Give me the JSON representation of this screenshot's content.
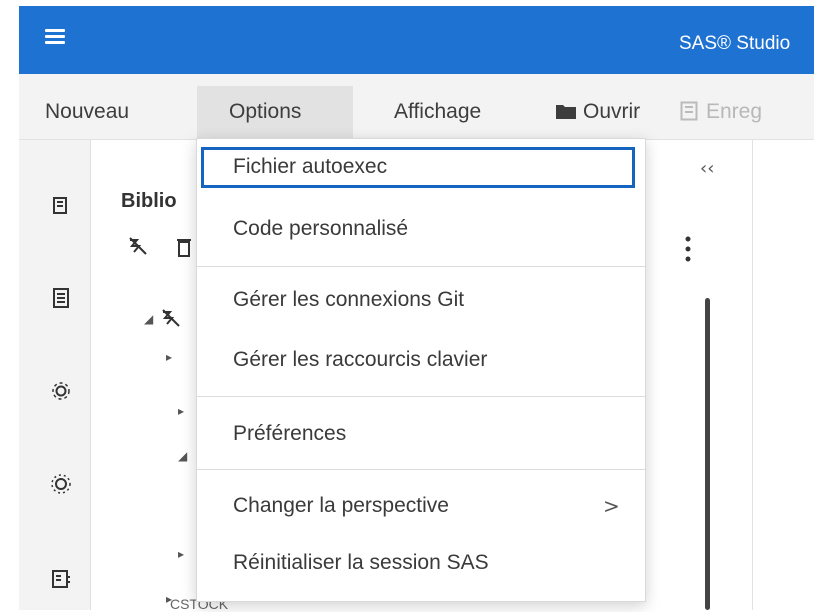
{
  "app": {
    "title": "SAS® Studio"
  },
  "menubar": {
    "new_label": "Nouveau",
    "options_label": "Options",
    "view_label": "Affichage",
    "open_label": "Ouvrir",
    "save_label": "Enreg"
  },
  "panel": {
    "title": "Biblio",
    "collapse_glyph": "‹‹"
  },
  "dropdown": {
    "items": [
      {
        "label": "Fichier autoexec",
        "focused": true
      },
      {
        "label": "Code personnalisé"
      },
      {
        "label": "Gérer les connexions Git"
      },
      {
        "label": "Gérer les raccourcis clavier"
      },
      {
        "label": "Préférences"
      },
      {
        "label": "Changer la perspective",
        "submenu": true
      },
      {
        "label": "Réinitialiser la session SAS"
      }
    ],
    "chevron": ">"
  },
  "tree": {
    "partial_label": "CSTOCK"
  },
  "colors": {
    "brand": "#1e72d2",
    "focus": "#1464c0"
  }
}
